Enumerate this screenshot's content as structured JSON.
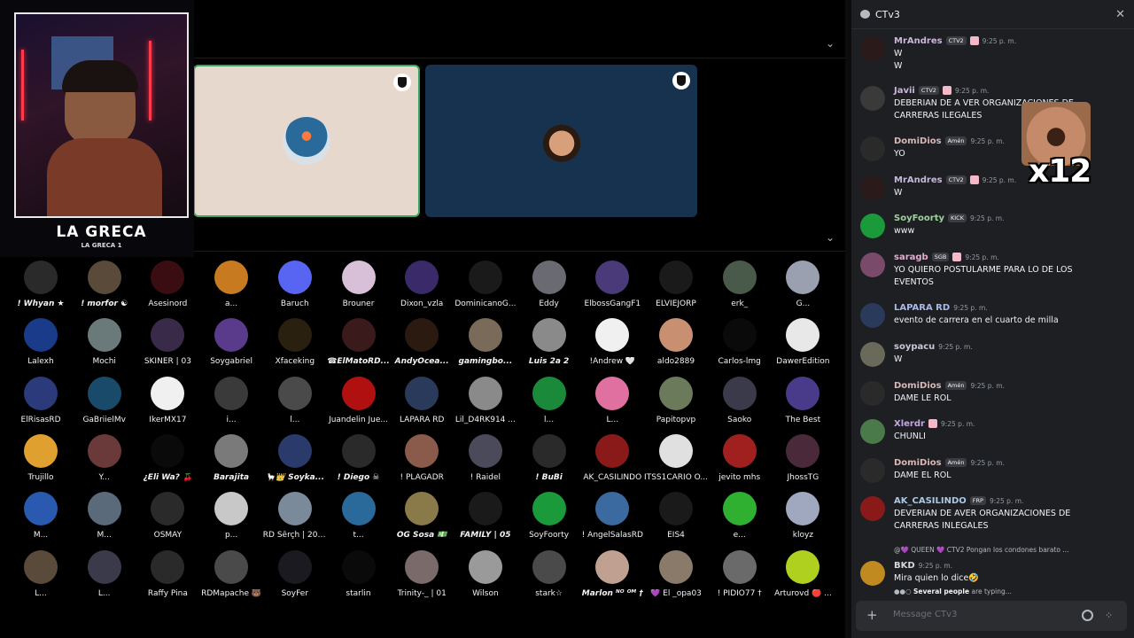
{
  "stream": {
    "webcam_caption": "LA GRECA",
    "webcam_subcaption": "LA GRECA 1"
  },
  "channel": {
    "name": "CTv3"
  },
  "members": [
    {
      "name": "! Whyan ★",
      "color": "#2a2a2a",
      "bold": true
    },
    {
      "name": "! morfor ☯",
      "color": "#5a4a3a",
      "bold": true
    },
    {
      "name": "Asesinord",
      "color": "#3a0d12",
      "bold": false
    },
    {
      "name": "a...",
      "color": "#c87a20",
      "bold": false
    },
    {
      "name": "Baruch",
      "color": "#5865f2",
      "bold": false
    },
    {
      "name": "Brouner",
      "color": "#d8c0d8",
      "bold": false
    },
    {
      "name": "Dixon_vzla",
      "color": "#3a2a6a",
      "bold": false
    },
    {
      "name": "DominicanoG...",
      "color": "#1a1a1a",
      "bold": false
    },
    {
      "name": "Eddy",
      "color": "#6a6a72",
      "bold": false
    },
    {
      "name": "ElbossGangF1",
      "color": "#4a3a7a",
      "bold": false
    },
    {
      "name": "ELVIEJORP",
      "color": "#1a1a1a",
      "bold": false
    },
    {
      "name": "erk_",
      "color": "#4a5a4a",
      "bold": false
    },
    {
      "name": "G...",
      "color": "#9aa0b0",
      "bold": false
    },
    {
      "name": "Lalexh",
      "color": "#1a3a8a",
      "bold": false
    },
    {
      "name": "Mochi",
      "color": "#6a7a7a",
      "bold": false
    },
    {
      "name": "SKINER | 03",
      "color": "#3a2a4a",
      "bold": false
    },
    {
      "name": "Soygabriel",
      "color": "#5a3a8a",
      "bold": false
    },
    {
      "name": "Xfaceking",
      "color": "#2a2010",
      "bold": false
    },
    {
      "name": "☎ElMatoRD...",
      "color": "#3a1a1a",
      "bold": true
    },
    {
      "name": "AndyOcea...",
      "color": "#2a1a10",
      "bold": true
    },
    {
      "name": "gamingbo...",
      "color": "#7a6a5a",
      "bold": true
    },
    {
      "name": "Luis 2a 2",
      "color": "#8a8a8a",
      "bold": true
    },
    {
      "name": "!Andrew 🤍",
      "color": "#f0f0f0",
      "bold": false
    },
    {
      "name": "aldo2889",
      "color": "#c89070",
      "bold": false
    },
    {
      "name": "Carlos-lmg",
      "color": "#0a0a0a",
      "bold": false
    },
    {
      "name": "DawerEdition",
      "color": "#e8e8e8",
      "bold": false
    },
    {
      "name": "ElRisasRD",
      "color": "#2a3a7a",
      "bold": false
    },
    {
      "name": "GaBriielMv",
      "color": "#1a4a6a",
      "bold": false
    },
    {
      "name": "IkerMX17",
      "color": "#f0f0f0",
      "bold": false
    },
    {
      "name": "i...",
      "color": "#3a3a3a",
      "bold": false
    },
    {
      "name": "l...",
      "color": "#4a4a4a",
      "bold": false
    },
    {
      "name": "Juandelin Jue...",
      "color": "#b01010",
      "bold": false
    },
    {
      "name": "LAPARA RD",
      "color": "#2a3a5a",
      "bold": false
    },
    {
      "name": "Lil_D4RK914 ...",
      "color": "#8a8a8a",
      "bold": false
    },
    {
      "name": "l...",
      "color": "#1a8a3a",
      "bold": false
    },
    {
      "name": "L...",
      "color": "#e070a0",
      "bold": false
    },
    {
      "name": "Papitopvp",
      "color": "#6a7a5a",
      "bold": false
    },
    {
      "name": "Saoko",
      "color": "#3a3a4a",
      "bold": false
    },
    {
      "name": "The Best",
      "color": "#4a3a8a",
      "bold": false
    },
    {
      "name": "Trujillo",
      "color": "#e0a030",
      "bold": false
    },
    {
      "name": "Y...",
      "color": "#6a3a3a",
      "bold": false
    },
    {
      "name": "¿Eli Wa? 🍒",
      "color": "#0a0a0a",
      "bold": true
    },
    {
      "name": "Barajita",
      "color": "#7a7a7a",
      "bold": true
    },
    {
      "name": "🦙👑 Soyka...",
      "color": "#2a3a6a",
      "bold": true
    },
    {
      "name": "! Diego ☠",
      "color": "#2a2a2a",
      "bold": true
    },
    {
      "name": "! PLAGADR",
      "color": "#8a5a4a",
      "bold": false
    },
    {
      "name": "! Raidel",
      "color": "#4a4a5a",
      "bold": false
    },
    {
      "name": "! BuBi",
      "color": "#2a2a2a",
      "bold": true
    },
    {
      "name": "AK_CASILINDO",
      "color": "#8a1a1a",
      "bold": false
    },
    {
      "name": "ITSS1CARIO O...",
      "color": "#e0e0e0",
      "bold": false
    },
    {
      "name": "jevito mhs",
      "color": "#a02020",
      "bold": false
    },
    {
      "name": "JhossTG",
      "color": "#4a2a3a",
      "bold": false
    },
    {
      "name": "M...",
      "color": "#2a5ab0",
      "bold": false
    },
    {
      "name": "M...",
      "color": "#5a6a7a",
      "bold": false
    },
    {
      "name": "OSMAY",
      "color": "#2a2a2a",
      "bold": false
    },
    {
      "name": "p...",
      "color": "#c8c8c8",
      "bold": false
    },
    {
      "name": "RD Šêrçh | 20 ...",
      "color": "#7a8a9a",
      "bold": false
    },
    {
      "name": "t...",
      "color": "#2a6a9a",
      "bold": false
    },
    {
      "name": "OG Sosa 💵",
      "color": "#8a7a4a",
      "bold": true
    },
    {
      "name": "FAMILY | 05",
      "color": "#1a1a1a",
      "bold": true
    },
    {
      "name": "SoyFoorty",
      "color": "#1a9a3a",
      "bold": false
    },
    {
      "name": "! AngelSalasRD",
      "color": "#3a6aa0",
      "bold": false
    },
    {
      "name": "EIS4",
      "color": "#1a1a1a",
      "bold": false
    },
    {
      "name": "e...",
      "color": "#30b030",
      "bold": false
    },
    {
      "name": "kloyz",
      "color": "#a0a8c0",
      "bold": false
    },
    {
      "name": "L...",
      "color": "#5a4a3a",
      "bold": false
    },
    {
      "name": "L...",
      "color": "#3a3a4a",
      "bold": false
    },
    {
      "name": "Raffy Pina",
      "color": "#2a2a2a",
      "bold": false
    },
    {
      "name": "RDMapache 🐻",
      "color": "#4a4a4a",
      "bold": false
    },
    {
      "name": "SoyFer",
      "color": "#1a1a20",
      "bold": false
    },
    {
      "name": "starlin",
      "color": "#0a0a0a",
      "bold": false
    },
    {
      "name": "Trinity-_ | 01",
      "color": "#7a6a6a",
      "bold": false
    },
    {
      "name": "Wilson",
      "color": "#9a9a9a",
      "bold": false
    },
    {
      "name": "stark☆",
      "color": "#4a4a4a",
      "bold": false
    },
    {
      "name": "Marlon ᴺᴼ ᴼᴹ †",
      "color": "#c0a090",
      "bold": true
    },
    {
      "name": "💜 El _opa03",
      "color": "#8a7a6a",
      "bold": false
    },
    {
      "name": "! PIDIO77 †",
      "color": "#6a6a6a",
      "bold": false
    },
    {
      "name": "Arturovd 🔴 ...",
      "color": "#b0d020",
      "bold": false
    }
  ],
  "chat": {
    "messages": [
      {
        "user": "MrAndres",
        "color": "#c9b7d9",
        "tags": [
          "CTV2"
        ],
        "pink": true,
        "time": "9:25 p. m.",
        "lines": [
          "W",
          "W"
        ],
        "avatar": "#2a1a1a"
      },
      {
        "user": "Javii",
        "color": "#c9b7d9",
        "tags": [
          "CTV2"
        ],
        "pink": true,
        "time": "9:25 p. m.",
        "lines": [
          "DEBERIAN DE A VER ORGANIZACIONES  DE CARRERAS ILEGALES"
        ],
        "avatar": "#3a3a3a"
      },
      {
        "user": "DomiDios",
        "color": "#d9b7b7",
        "tags": [
          "Amén"
        ],
        "pink": false,
        "time": "9:25 p. m.",
        "lines": [
          "YO"
        ],
        "avatar": "#2a2a2a"
      },
      {
        "user": "MrAndres",
        "color": "#c9b7d9",
        "tags": [
          "CTV2"
        ],
        "pink": true,
        "time": "9:25 p. m.",
        "lines": [
          "W"
        ],
        "avatar": "#2a1a1a"
      },
      {
        "user": "SoyFoorty",
        "color": "#a0d0a0",
        "tags": [
          "KICK"
        ],
        "pink": false,
        "time": "9:25 p. m.",
        "lines": [
          "www"
        ],
        "avatar": "#1a9a3a"
      },
      {
        "user": "saragb",
        "color": "#e0b0d0",
        "tags": [
          "SGB"
        ],
        "pink": true,
        "time": "9:25 p. m.",
        "lines": [
          "YO QUIERO POSTULARME PARA LO DE LOS EVENTOS"
        ],
        "avatar": "#7a4a6a"
      },
      {
        "user": "LAPARA RD",
        "color": "#a8b8e8",
        "tags": [],
        "pink": false,
        "time": "9:25 p. m.",
        "lines": [
          "evento de carrera en el cuarto de milla"
        ],
        "avatar": "#2a3a5a"
      },
      {
        "user": "soypacu",
        "color": "#c8c8d8",
        "tags": [],
        "pink": false,
        "time": "9:25 p. m.",
        "lines": [
          "W"
        ],
        "avatar": "#6a6a5a"
      },
      {
        "user": "DomiDios",
        "color": "#d9b7b7",
        "tags": [
          "Amén"
        ],
        "pink": false,
        "time": "9:25 p. m.",
        "lines": [
          "DAME LE ROL"
        ],
        "avatar": "#2a2a2a"
      },
      {
        "user": "Xlerdr",
        "color": "#c0a8e0",
        "tags": [],
        "pink": true,
        "time": "9:25 p. m.",
        "lines": [
          "CHUNLI"
        ],
        "avatar": "#4a7a4a"
      },
      {
        "user": "DomiDios",
        "color": "#d9b7b7",
        "tags": [
          "Amén"
        ],
        "pink": false,
        "time": "9:25 p. m.",
        "lines": [
          "DAME EL ROL"
        ],
        "avatar": "#2a2a2a"
      },
      {
        "user": "AK_CASILINDO",
        "color": "#a8c8e8",
        "tags": [
          "FRP"
        ],
        "pink": false,
        "time": "9:25 p. m.",
        "lines": [
          "DEVERIAN DE AVER  ORGANIZACIONES  DE CARRERAS INLEGALES"
        ],
        "avatar": "#8a1a1a"
      },
      {
        "user": "BKD",
        "color": "#d8d8d8",
        "tags": [],
        "pink": false,
        "time": "9:25 p. m.",
        "lines": [
          "Mira quien lo dice🤣"
        ],
        "avatar": "#c08a20"
      }
    ],
    "reply_preview": "@💜 QUEEN 💜  CTV2  Pongan los condones barato ...",
    "emote_text": "x12",
    "typing_user": "Several people",
    "typing_suffix": "are typing...",
    "input_placeholder": "Message CTv3"
  }
}
